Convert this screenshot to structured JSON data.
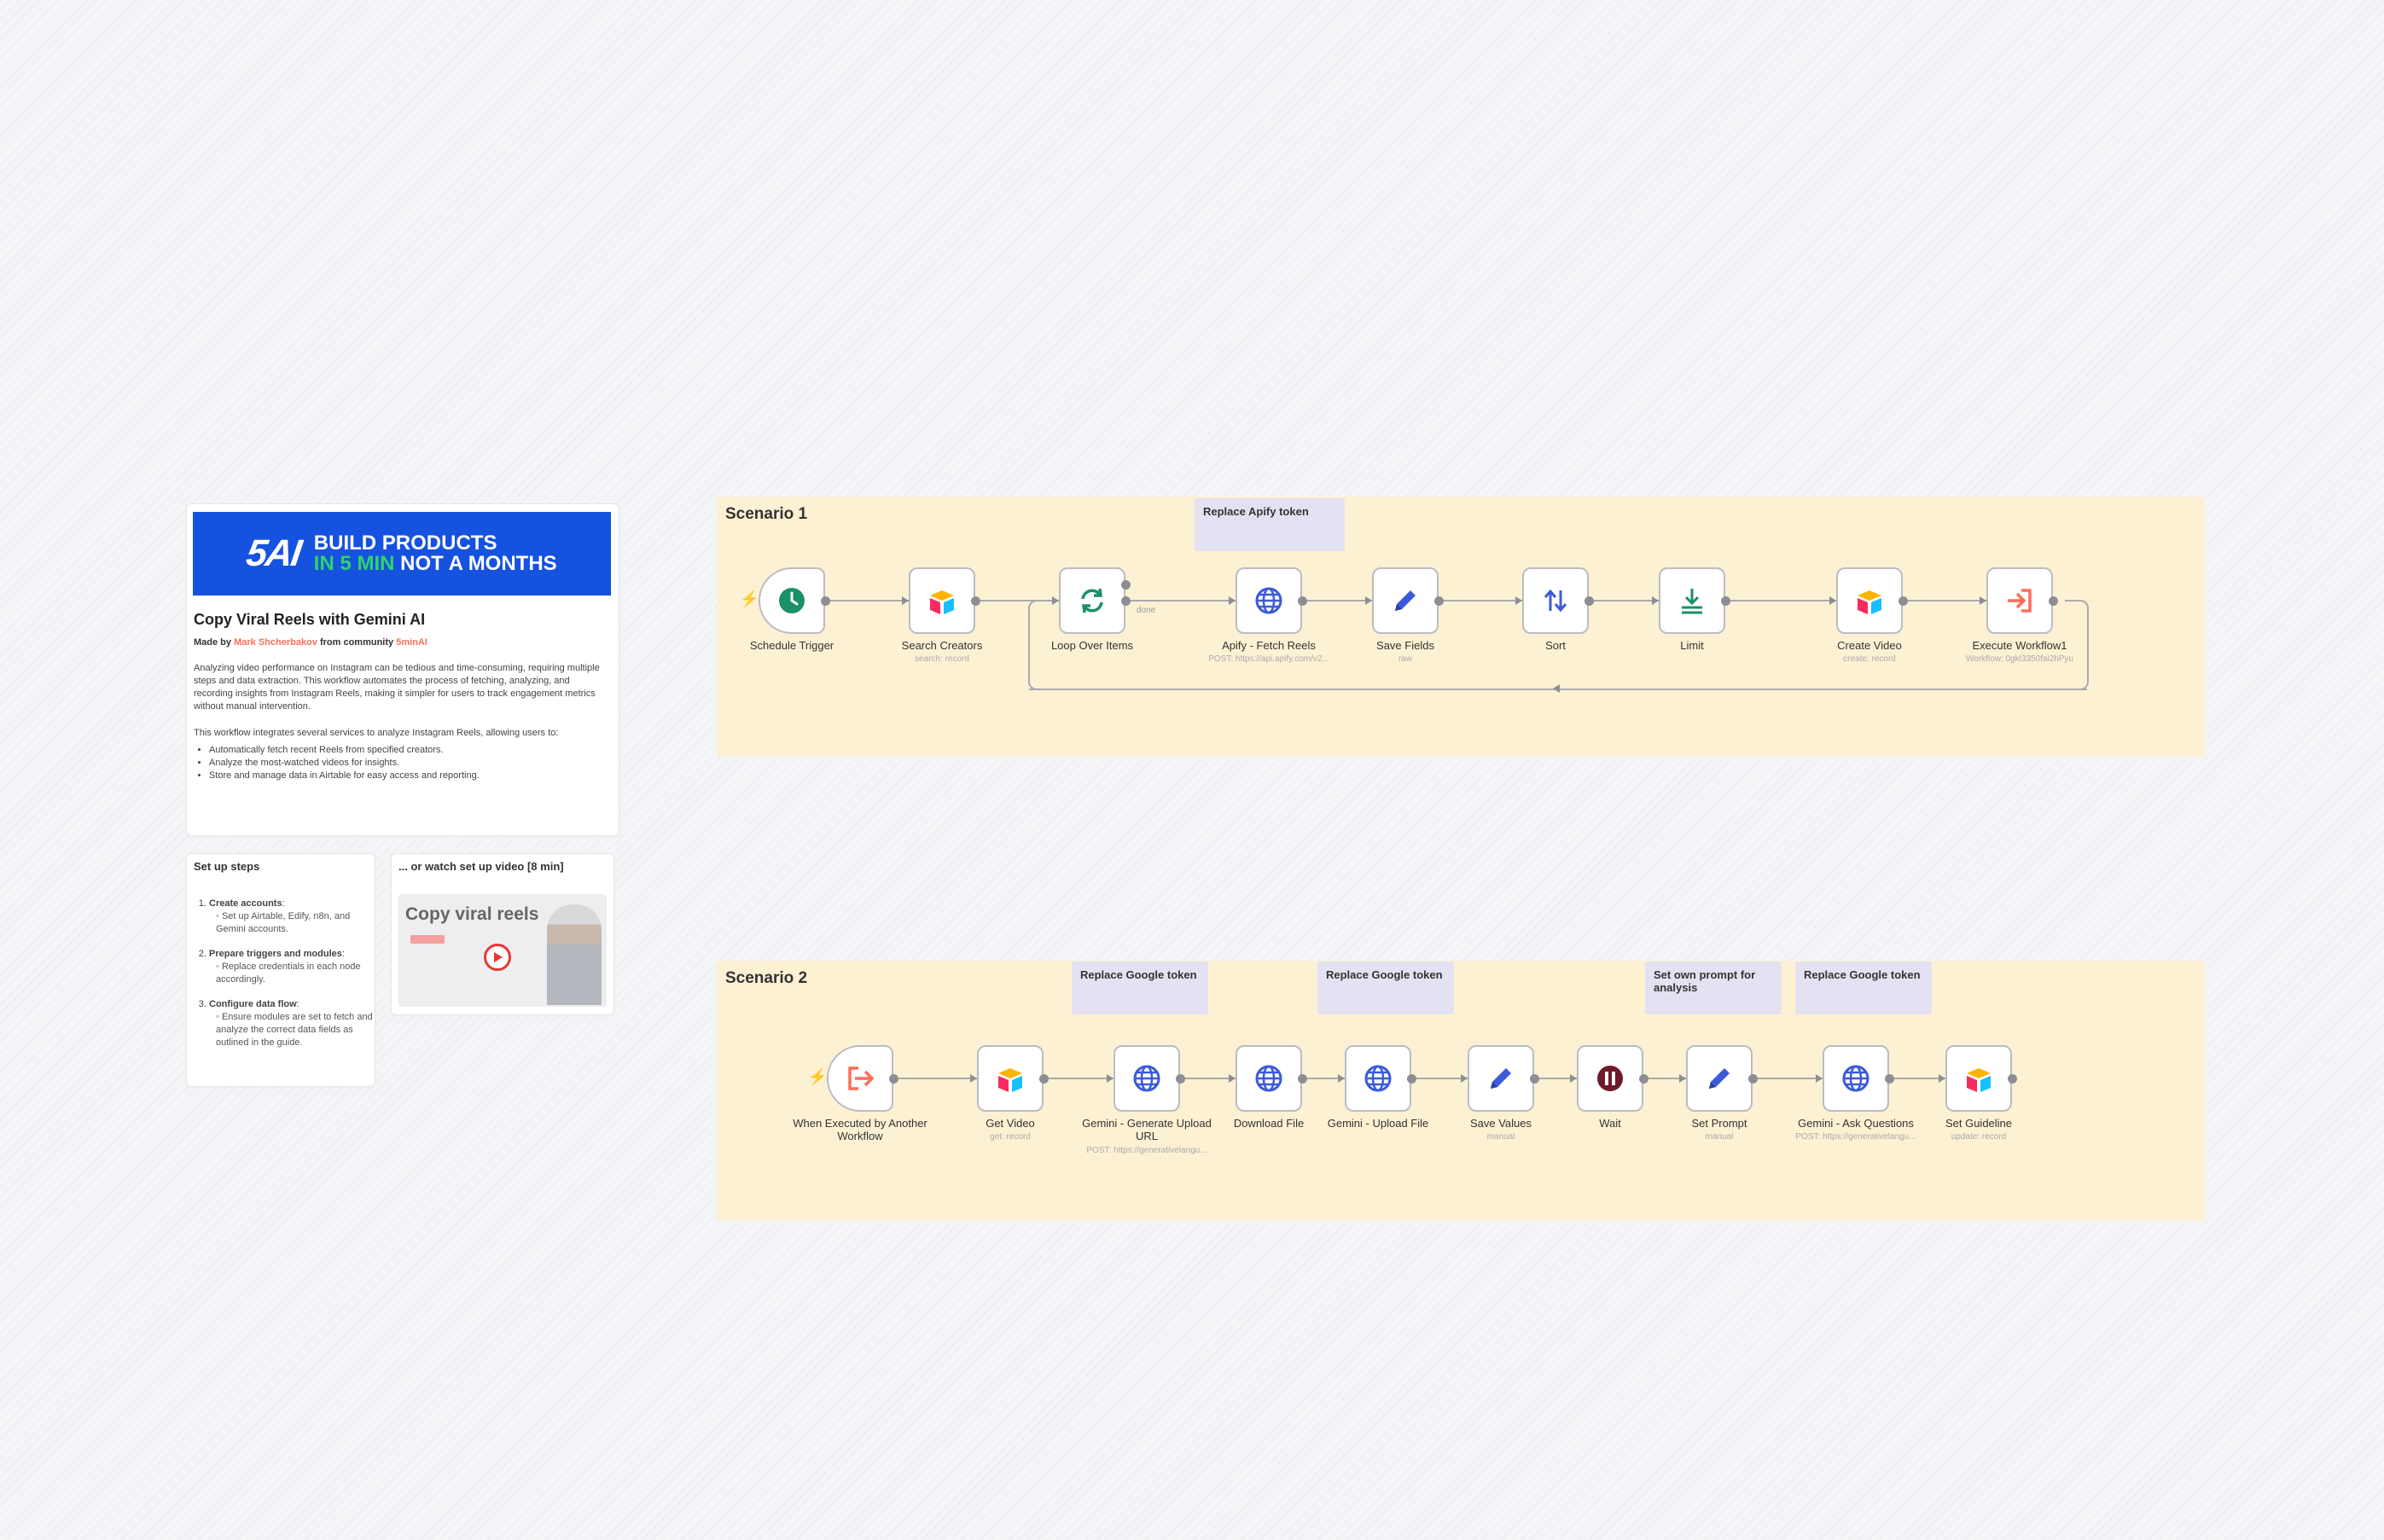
{
  "info": {
    "banner_logo": "5AI",
    "banner_line1": "BUILD PRODUCTS",
    "banner_line2_highlight": "IN 5 MIN",
    "banner_line2_rest": "NOT A MONTHS",
    "title": "Copy Viral Reels with Gemini AI",
    "made_by_prefix": "Made by",
    "author": "Mark Shcherbakov",
    "community_prefix": "from community",
    "community": "5minAI",
    "para1": "Analyzing video performance on Instagram can be tedious and time-consuming, requiring multiple steps and data extraction. This workflow automates the process of fetching, analyzing, and recording insights from Instagram Reels, making it simpler for users to track engagement metrics without manual intervention.",
    "para2": "This workflow integrates several services to analyze Instagram Reels, allowing users to:",
    "bullets": [
      "Automatically fetch recent Reels from specified creators.",
      "Analyze the most-watched videos for insights.",
      "Store and manage data in Airtable for easy access and reporting."
    ]
  },
  "setup": {
    "title": "Set up steps",
    "steps": [
      {
        "title": "Create accounts",
        "sub": "Set up Airtable, Edify, n8n, and Gemini accounts."
      },
      {
        "title": "Prepare triggers and modules",
        "sub": "Replace credentials in each node accordingly."
      },
      {
        "title": "Configure data flow",
        "sub": "Ensure modules are set to fetch and analyze the correct data fields as outlined in the guide."
      }
    ]
  },
  "video": {
    "title": "... or watch set up video [8 min]",
    "thumb_text": "Copy viral reels"
  },
  "scenario1": {
    "label": "Scenario 1",
    "sticky": "Replace Apify token",
    "nodes": [
      {
        "label": "Schedule Trigger",
        "sub": "",
        "icon": "clock-icon"
      },
      {
        "label": "Search Creators",
        "sub": "search: record",
        "icon": "airtable-icon"
      },
      {
        "label": "Loop Over Items",
        "sub": "",
        "icon": "loop-icon"
      },
      {
        "label": "Apify - Fetch Reels",
        "sub": "POST: https://api.apify.com/v2...",
        "icon": "globe-icon"
      },
      {
        "label": "Save Fields",
        "sub": "raw",
        "icon": "pencil-icon"
      },
      {
        "label": "Sort",
        "sub": "",
        "icon": "sort-icon"
      },
      {
        "label": "Limit",
        "sub": "",
        "icon": "limit-icon"
      },
      {
        "label": "Create Video",
        "sub": "create: record",
        "icon": "airtable-icon"
      },
      {
        "label": "Execute Workflow1",
        "sub": "Workflow: 0gkl3350fai2hPyu",
        "icon": "execute-workflow-icon"
      }
    ],
    "connector_labels": {
      "loop_done": "done"
    }
  },
  "scenario2": {
    "label": "Scenario 2",
    "stickies": [
      "Replace Google token",
      "Replace Google token",
      "Set own prompt for analysis",
      "Replace Google token"
    ],
    "nodes": [
      {
        "label": "When Executed by Another Workflow",
        "sub": "",
        "icon": "workflow-trigger-icon"
      },
      {
        "label": "Get Video",
        "sub": "get: record",
        "icon": "airtable-icon"
      },
      {
        "label": "Gemini - Generate Upload URL",
        "sub": "POST: https://generativelangu...",
        "icon": "globe-icon"
      },
      {
        "label": "Download File",
        "sub": "",
        "icon": "globe-icon"
      },
      {
        "label": "Gemini - Upload File",
        "sub": "",
        "icon": "globe-icon"
      },
      {
        "label": "Save Values",
        "sub": "manual",
        "icon": "pencil-icon"
      },
      {
        "label": "Wait",
        "sub": "",
        "icon": "pause-icon"
      },
      {
        "label": "Set Prompt",
        "sub": "manual",
        "icon": "pencil-icon"
      },
      {
        "label": "Gemini - Ask Questions",
        "sub": "POST: https://generativelangu...",
        "icon": "globe-icon"
      },
      {
        "label": "Set Guideline",
        "sub": "update: record",
        "icon": "airtable-icon"
      }
    ]
  },
  "colors": {
    "scenario_bg": "#fdf1d3",
    "sticky_bg": "#e4e1f2",
    "banner_bg": "#1552e0",
    "accent": "#ff6d5a",
    "icon_blue": "#3b5bdb",
    "icon_green": "#1a8f6a"
  }
}
